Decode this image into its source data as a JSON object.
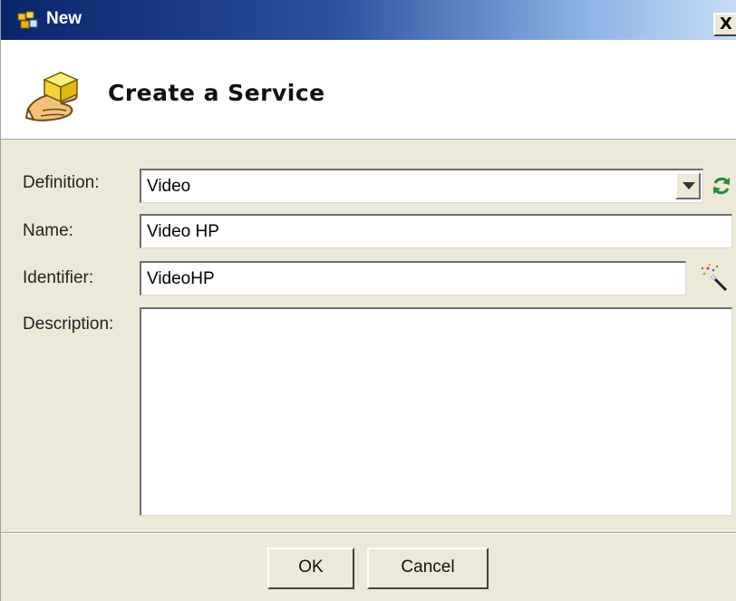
{
  "window": {
    "title": "New",
    "close_label": "X",
    "title_bar_color": "#0a246a"
  },
  "header": {
    "title": "Create a Service",
    "icon": "hand-holding-box-icon"
  },
  "form": {
    "definition": {
      "label": "Definition:",
      "value": "Video"
    },
    "name": {
      "label": "Name:",
      "value": "Video HP"
    },
    "identifier": {
      "label": "Identifier:",
      "value": "VideoHP"
    },
    "description": {
      "label": "Description:",
      "value": ""
    }
  },
  "icons": {
    "refresh": "refresh-icon",
    "wand": "magic-wand-icon"
  },
  "buttons": {
    "ok": "OK",
    "cancel": "Cancel"
  }
}
